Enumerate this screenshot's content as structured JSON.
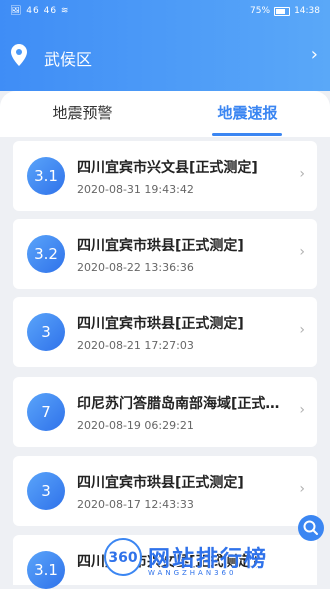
{
  "status_bar": {
    "left": "🖼 46 46 ≋",
    "battery": "75%",
    "time": "14:38"
  },
  "location": {
    "name": "武侯区",
    "chevron": "›",
    "icon": "location-pin-icon"
  },
  "tabs": [
    {
      "label": "地震预警"
    },
    {
      "label": "地震速报"
    }
  ],
  "events": [
    {
      "magnitude": "3.1",
      "title": "四川宜宾市兴文县[正式测定]",
      "time": "2020-08-31 19:43:42"
    },
    {
      "magnitude": "3.2",
      "title": "四川宜宾市珙县[正式测定]",
      "time": "2020-08-22 13:36:36"
    },
    {
      "magnitude": "3",
      "title": "四川宜宾市珙县[正式测定]",
      "time": "2020-08-21 17:27:03"
    },
    {
      "magnitude": "7",
      "title": "印尼苏门答腊岛南部海域[正式测定]",
      "time": "2020-08-19 06:29:21"
    },
    {
      "magnitude": "3",
      "title": "四川宜宾市珙县[正式测定]",
      "time": "2020-08-17 12:43:33"
    },
    {
      "magnitude": "3.1",
      "title": "四川宜宾市兴文县[正式测定]",
      "time": ""
    }
  ],
  "watermark": {
    "badge": "360",
    "text": "网站排行榜",
    "sub": "WANGZHAN360"
  },
  "colors": {
    "accent": "#3b86f2",
    "header_start": "#3f8df6",
    "header_end": "#5aa8f8"
  }
}
